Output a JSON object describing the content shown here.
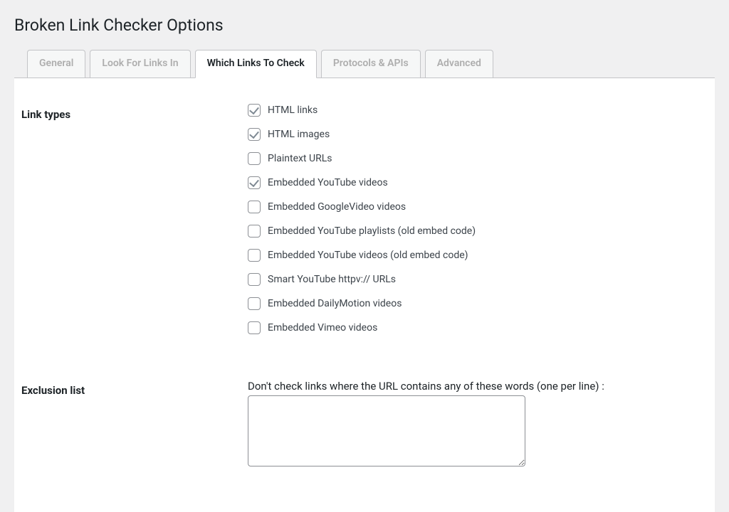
{
  "page_title": "Broken Link Checker Options",
  "tabs": [
    {
      "label": "General"
    },
    {
      "label": "Look For Links In"
    },
    {
      "label": "Which Links To Check"
    },
    {
      "label": "Protocols & APIs"
    },
    {
      "label": "Advanced"
    }
  ],
  "active_tab_index": 2,
  "link_types_heading": "Link types",
  "link_types": [
    {
      "label": "HTML links",
      "checked": true
    },
    {
      "label": "HTML images",
      "checked": true
    },
    {
      "label": "Plaintext URLs",
      "checked": false
    },
    {
      "label": "Embedded YouTube videos",
      "checked": true
    },
    {
      "label": "Embedded GoogleVideo videos",
      "checked": false
    },
    {
      "label": "Embedded YouTube playlists (old embed code)",
      "checked": false
    },
    {
      "label": "Embedded YouTube videos (old embed code)",
      "checked": false
    },
    {
      "label": "Smart YouTube httpv:// URLs",
      "checked": false
    },
    {
      "label": "Embedded DailyMotion videos",
      "checked": false
    },
    {
      "label": "Embedded Vimeo videos",
      "checked": false
    }
  ],
  "exclusion_heading": "Exclusion list",
  "exclusion_desc": "Don't check links where the URL contains any of these words (one per line) :",
  "exclusion_value": ""
}
